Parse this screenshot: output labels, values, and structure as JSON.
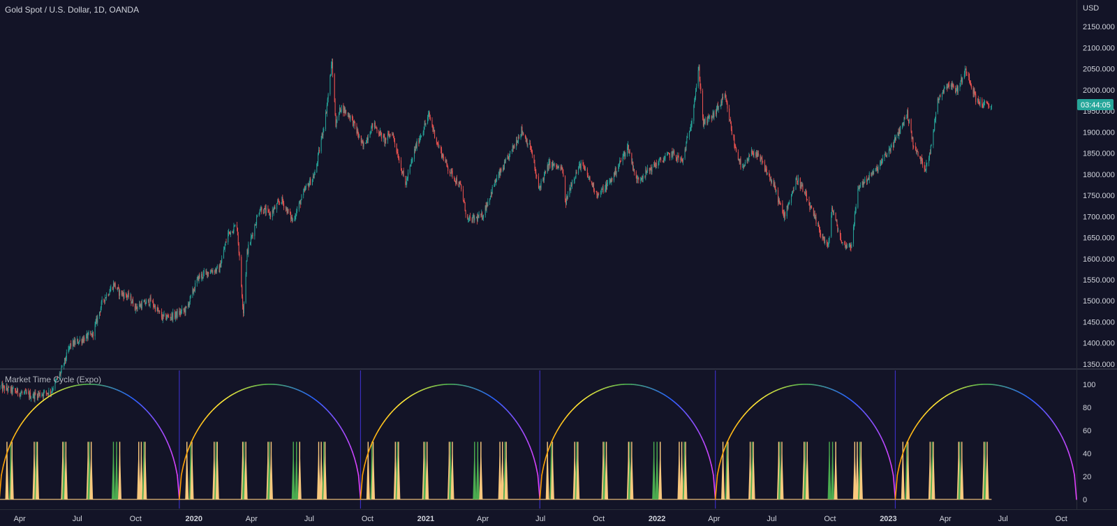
{
  "header": {
    "title": "Gold Spot / U.S. Dollar, 1D, OANDA",
    "currency": "USD",
    "countdown": "03:44:05"
  },
  "indicator": {
    "title": "Market Time Cycle (Expo)"
  },
  "colors": {
    "background": "#131427",
    "candle_up": "#26a69a",
    "candle_down": "#ef5350",
    "countdown_bg": "#26a69a",
    "cycle_divider": "#3b2fbf",
    "cycle_gradient": [
      "#ff9800",
      "#ffeb3b",
      "#4caf50",
      "#2962ff",
      "#e040fb"
    ],
    "spike_green": "#4caf50",
    "spike_tan": "#ffcc80"
  },
  "chart_data": [
    {
      "type": "candlestick",
      "title": "Gold Spot / U.S. Dollar, 1D, OANDA",
      "ylabel": "USD",
      "ylim": [
        1340,
        2180
      ],
      "yticks": [
        1350,
        1400,
        1450,
        1500,
        1550,
        1600,
        1650,
        1700,
        1750,
        1800,
        1850,
        1900,
        1950,
        2000,
        2050,
        2100,
        2150
      ],
      "ytick_labels": [
        "1350.000",
        "1400.000",
        "1450.000",
        "1500.000",
        "1550.000",
        "1600.000",
        "1650.000",
        "1700.000",
        "1750.000",
        "1800.000",
        "1850.000",
        "1900.000",
        "1950.000",
        "2000.000",
        "2050.000",
        "2100.000",
        "2150.000"
      ],
      "x_range": [
        "2019-03-01",
        "2023-10-25"
      ],
      "xtick_labels": [
        {
          "date": "2019-04-01",
          "label": "Apr",
          "bold": false
        },
        {
          "date": "2019-07-01",
          "label": "Jul",
          "bold": false
        },
        {
          "date": "2019-10-01",
          "label": "Oct",
          "bold": false
        },
        {
          "date": "2020-01-01",
          "label": "2020",
          "bold": true
        },
        {
          "date": "2020-04-01",
          "label": "Apr",
          "bold": false
        },
        {
          "date": "2020-07-01",
          "label": "Jul",
          "bold": false
        },
        {
          "date": "2020-10-01",
          "label": "Oct",
          "bold": false
        },
        {
          "date": "2021-01-01",
          "label": "2021",
          "bold": true
        },
        {
          "date": "2021-04-01",
          "label": "Apr",
          "bold": false
        },
        {
          "date": "2021-07-01",
          "label": "Jul",
          "bold": false
        },
        {
          "date": "2021-10-01",
          "label": "Oct",
          "bold": false
        },
        {
          "date": "2022-01-01",
          "label": "2022",
          "bold": true
        },
        {
          "date": "2022-04-01",
          "label": "Apr",
          "bold": false
        },
        {
          "date": "2022-07-01",
          "label": "Jul",
          "bold": false
        },
        {
          "date": "2022-10-01",
          "label": "Oct",
          "bold": false
        },
        {
          "date": "2023-01-01",
          "label": "2023",
          "bold": true
        },
        {
          "date": "2023-04-01",
          "label": "Apr",
          "bold": false
        },
        {
          "date": "2023-07-01",
          "label": "Jul",
          "bold": false
        },
        {
          "date": "2023-10-01",
          "label": "Oct",
          "bold": false
        }
      ],
      "close_path": [
        {
          "date": "2019-03-01",
          "price": 1295
        },
        {
          "date": "2019-04-20",
          "price": 1275
        },
        {
          "date": "2019-05-20",
          "price": 1285
        },
        {
          "date": "2019-06-05",
          "price": 1330
        },
        {
          "date": "2019-06-20",
          "price": 1395
        },
        {
          "date": "2019-07-10",
          "price": 1410
        },
        {
          "date": "2019-07-25",
          "price": 1420
        },
        {
          "date": "2019-08-10",
          "price": 1500
        },
        {
          "date": "2019-08-28",
          "price": 1540
        },
        {
          "date": "2019-09-05",
          "price": 1520
        },
        {
          "date": "2019-09-20",
          "price": 1510
        },
        {
          "date": "2019-10-01",
          "price": 1485
        },
        {
          "date": "2019-10-25",
          "price": 1500
        },
        {
          "date": "2019-11-12",
          "price": 1460
        },
        {
          "date": "2019-12-01",
          "price": 1465
        },
        {
          "date": "2019-12-20",
          "price": 1480
        },
        {
          "date": "2020-01-08",
          "price": 1555
        },
        {
          "date": "2020-01-25",
          "price": 1570
        },
        {
          "date": "2020-02-10",
          "price": 1575
        },
        {
          "date": "2020-02-24",
          "price": 1660
        },
        {
          "date": "2020-03-09",
          "price": 1680
        },
        {
          "date": "2020-03-19",
          "price": 1475
        },
        {
          "date": "2020-03-25",
          "price": 1615
        },
        {
          "date": "2020-04-14",
          "price": 1720
        },
        {
          "date": "2020-05-01",
          "price": 1705
        },
        {
          "date": "2020-05-18",
          "price": 1740
        },
        {
          "date": "2020-06-05",
          "price": 1690
        },
        {
          "date": "2020-06-25",
          "price": 1765
        },
        {
          "date": "2020-07-10",
          "price": 1800
        },
        {
          "date": "2020-07-27",
          "price": 1940
        },
        {
          "date": "2020-08-06",
          "price": 2065
        },
        {
          "date": "2020-08-12",
          "price": 1920
        },
        {
          "date": "2020-08-20",
          "price": 1960
        },
        {
          "date": "2020-09-05",
          "price": 1935
        },
        {
          "date": "2020-09-24",
          "price": 1865
        },
        {
          "date": "2020-10-10",
          "price": 1920
        },
        {
          "date": "2020-10-28",
          "price": 1880
        },
        {
          "date": "2020-11-09",
          "price": 1900
        },
        {
          "date": "2020-11-30",
          "price": 1775
        },
        {
          "date": "2020-12-15",
          "price": 1860
        },
        {
          "date": "2021-01-06",
          "price": 1940
        },
        {
          "date": "2021-01-20",
          "price": 1870
        },
        {
          "date": "2021-02-05",
          "price": 1815
        },
        {
          "date": "2021-02-25",
          "price": 1770
        },
        {
          "date": "2021-03-08",
          "price": 1690
        },
        {
          "date": "2021-03-31",
          "price": 1700
        },
        {
          "date": "2021-04-20",
          "price": 1780
        },
        {
          "date": "2021-05-10",
          "price": 1835
        },
        {
          "date": "2021-06-01",
          "price": 1905
        },
        {
          "date": "2021-06-16",
          "price": 1860
        },
        {
          "date": "2021-06-28",
          "price": 1765
        },
        {
          "date": "2021-07-15",
          "price": 1825
        },
        {
          "date": "2021-08-05",
          "price": 1810
        },
        {
          "date": "2021-08-09",
          "price": 1730
        },
        {
          "date": "2021-08-20",
          "price": 1785
        },
        {
          "date": "2021-09-03",
          "price": 1825
        },
        {
          "date": "2021-09-30",
          "price": 1750
        },
        {
          "date": "2021-10-20",
          "price": 1785
        },
        {
          "date": "2021-11-16",
          "price": 1865
        },
        {
          "date": "2021-11-30",
          "price": 1785
        },
        {
          "date": "2021-12-31",
          "price": 1825
        },
        {
          "date": "2022-01-25",
          "price": 1850
        },
        {
          "date": "2022-02-10",
          "price": 1830
        },
        {
          "date": "2022-02-24",
          "price": 1925
        },
        {
          "date": "2022-03-08",
          "price": 2050
        },
        {
          "date": "2022-03-15",
          "price": 1920
        },
        {
          "date": "2022-03-31",
          "price": 1940
        },
        {
          "date": "2022-04-18",
          "price": 1985
        },
        {
          "date": "2022-05-03",
          "price": 1870
        },
        {
          "date": "2022-05-16",
          "price": 1810
        },
        {
          "date": "2022-06-01",
          "price": 1855
        },
        {
          "date": "2022-06-15",
          "price": 1830
        },
        {
          "date": "2022-07-05",
          "price": 1770
        },
        {
          "date": "2022-07-20",
          "price": 1700
        },
        {
          "date": "2022-08-10",
          "price": 1790
        },
        {
          "date": "2022-08-20",
          "price": 1760
        },
        {
          "date": "2022-09-15",
          "price": 1665
        },
        {
          "date": "2022-09-28",
          "price": 1625
        },
        {
          "date": "2022-10-04",
          "price": 1720
        },
        {
          "date": "2022-10-20",
          "price": 1635
        },
        {
          "date": "2022-11-03",
          "price": 1630
        },
        {
          "date": "2022-11-15",
          "price": 1770
        },
        {
          "date": "2022-12-13",
          "price": 1810
        },
        {
          "date": "2023-01-10",
          "price": 1875
        },
        {
          "date": "2023-01-31",
          "price": 1945
        },
        {
          "date": "2023-02-10",
          "price": 1865
        },
        {
          "date": "2023-02-28",
          "price": 1815
        },
        {
          "date": "2023-03-10",
          "price": 1865
        },
        {
          "date": "2023-03-20",
          "price": 1980
        },
        {
          "date": "2023-04-05",
          "price": 2015
        },
        {
          "date": "2023-04-20",
          "price": 2000
        },
        {
          "date": "2023-05-04",
          "price": 2050
        },
        {
          "date": "2023-05-20",
          "price": 1975
        },
        {
          "date": "2023-06-01",
          "price": 1965
        },
        {
          "date": "2023-06-13",
          "price": 1960
        }
      ]
    },
    {
      "type": "line",
      "title": "Market Time Cycle (Expo)",
      "ylim": [
        -8,
        112
      ],
      "yticks": [
        0,
        20,
        40,
        60,
        80,
        100
      ],
      "ytick_labels": [
        "0",
        "20",
        "40",
        "60",
        "80",
        "100"
      ],
      "cycle_boundaries": [
        "2019-02-28",
        "2019-12-09",
        "2020-09-20",
        "2021-06-30",
        "2022-04-03",
        "2023-01-12"
      ],
      "cycle_end": "2023-10-25",
      "cycle_series": {
        "name": "cycle",
        "shape": "semicircle",
        "min": 0,
        "max": 100
      },
      "spike_height": 50,
      "spike_pattern_days": [
        [
          12,
          "tan"
        ],
        [
          18,
          "green"
        ],
        [
          20,
          "tan"
        ],
        [
          55,
          "tan"
        ],
        [
          58,
          "green"
        ],
        [
          60,
          "tan"
        ],
        [
          100,
          "tan"
        ],
        [
          102,
          "green"
        ],
        [
          105,
          "tan"
        ],
        [
          140,
          "tan"
        ],
        [
          142,
          "green"
        ],
        [
          145,
          "tan"
        ],
        [
          180,
          "green"
        ],
        [
          185,
          "green"
        ],
        [
          190,
          "tan"
        ],
        [
          220,
          "tan"
        ],
        [
          224,
          "tan"
        ],
        [
          228,
          "green"
        ],
        [
          230,
          "tan"
        ]
      ]
    }
  ]
}
